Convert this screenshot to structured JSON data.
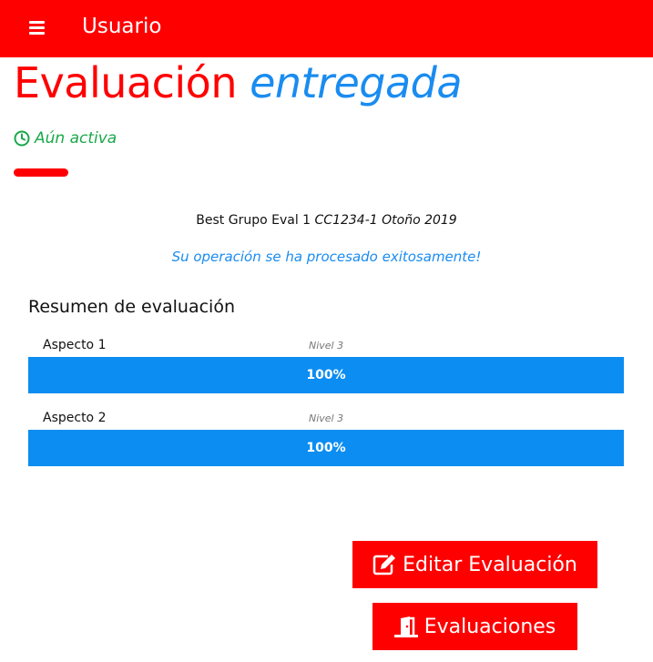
{
  "navbar": {
    "menu_icon": "hamburger-icon",
    "title": "Usuario",
    "color": "#ff0000"
  },
  "page": {
    "title_main": "Evaluación",
    "title_accent": "entregada",
    "status_icon": "clock-icon",
    "status": "Aún activa"
  },
  "group": {
    "name": "Best Grupo Eval 1",
    "course": "CC1234-1 Otoño 2019"
  },
  "message": "Su operación se ha procesado exitosamente!",
  "summary": {
    "title": "Resumen de evaluación",
    "aspects": [
      {
        "label": "Aspecto 1",
        "level": "Nivel 3",
        "value_text": "100%",
        "progress": 1.0
      },
      {
        "label": "Aspecto 2",
        "level": "Nivel 3",
        "value_text": "100%",
        "progress": 1.0
      }
    ]
  },
  "buttons": {
    "edit": {
      "label": "Editar Evaluación",
      "icon": "edit-icon"
    },
    "evaluations": {
      "label": "Evaluaciones",
      "icon": "door-icon"
    }
  },
  "colors": {
    "primary_red": "#ff0000",
    "accent_blue": "#1a8cf0",
    "progress_blue": "#0b8df2",
    "status_green": "#1aa84a"
  }
}
